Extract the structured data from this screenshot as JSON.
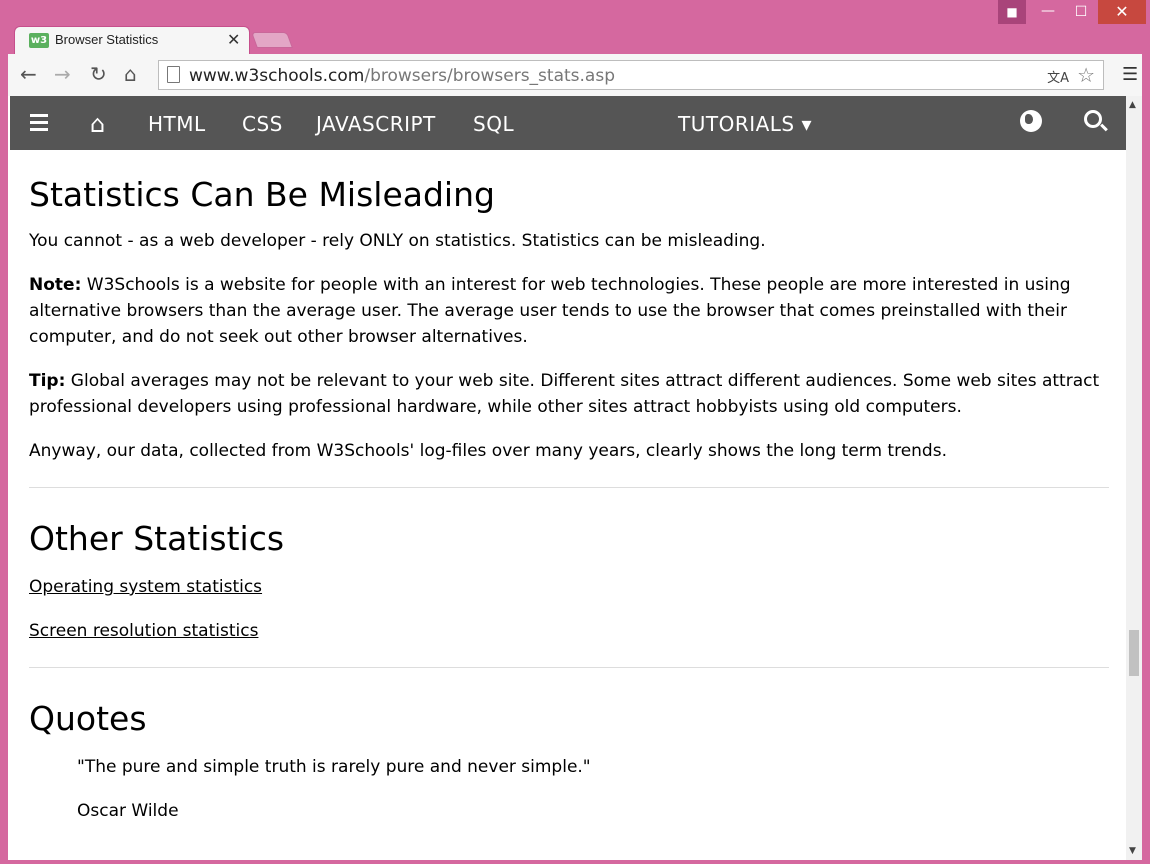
{
  "browser": {
    "tab_title": "Browser Statistics",
    "favicon_text": "w3",
    "tab_close": "✕",
    "url_host": "www.w3schools.com",
    "url_path": "/browsers/browsers_stats.asp",
    "window_controls": {
      "minimize": "—",
      "maximize": "☐",
      "close": "✕"
    }
  },
  "site_nav": {
    "items": [
      "HTML",
      "CSS",
      "JAVASCRIPT",
      "SQL"
    ],
    "tutorials": "TUTORIALS ▾"
  },
  "content": {
    "section1": {
      "heading": "Statistics Can Be Misleading",
      "p1": "You cannot - as a web developer - rely ONLY on statistics. Statistics can be misleading.",
      "note_label": "Note:",
      "note_text": " W3Schools is a website for people with an interest for web technologies. These people are more interested in using alternative browsers than the average user. The average user tends to use the browser that comes preinstalled with their computer, and do not seek out other browser alternatives.",
      "tip_label": "Tip:",
      "tip_text": " Global averages may not be relevant to your web site. Different sites attract different audiences. Some web sites attract professional developers using professional hardware, while other sites attract hobbyists using old computers.",
      "p4": "Anyway, our data, collected from W3Schools' log-files over many years, clearly shows the long term trends."
    },
    "section2": {
      "heading": "Other Statistics",
      "links": [
        "Operating system statistics",
        "Screen resolution statistics"
      ]
    },
    "section3": {
      "heading": "Quotes",
      "quote": "\"The pure and simple truth is rarely pure and never simple.\"",
      "author": "Oscar Wilde"
    }
  }
}
